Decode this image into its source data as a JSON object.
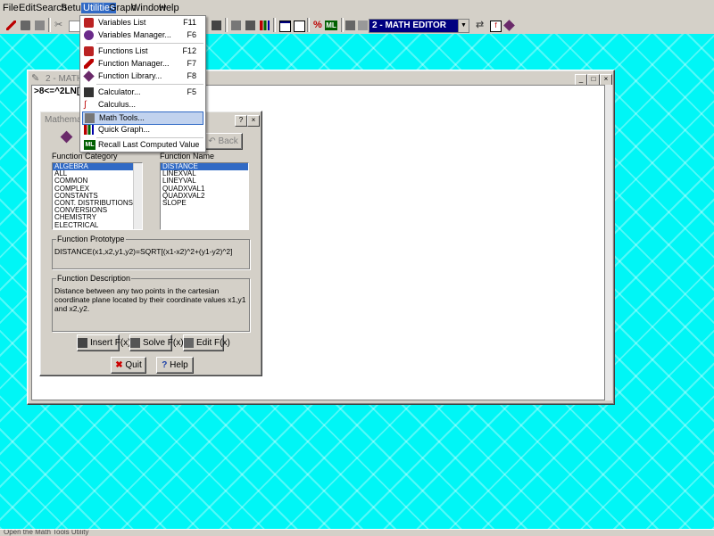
{
  "menubar": {
    "items": [
      {
        "label": "File"
      },
      {
        "label": "Edit"
      },
      {
        "label": "Search"
      },
      {
        "label": "Setup"
      },
      {
        "label": "Utilities"
      },
      {
        "label": "Graph"
      },
      {
        "label": "Window"
      },
      {
        "label": "Help"
      }
    ]
  },
  "toolbar": {
    "editor_combo_value": "2 - MATH EDITOR"
  },
  "utilities_menu": {
    "items": [
      {
        "label": "Variables List",
        "shortcut": "F11"
      },
      {
        "label": "Variables Manager...",
        "shortcut": "F6"
      },
      {
        "label": "Functions List",
        "shortcut": "F12"
      },
      {
        "label": "Function Manager...",
        "shortcut": "F7"
      },
      {
        "label": "Function Library...",
        "shortcut": "F8"
      },
      {
        "label": "Calculator...",
        "shortcut": "F5"
      },
      {
        "label": "Calculus...",
        "shortcut": ""
      },
      {
        "label": "Math Tools...",
        "shortcut": ""
      },
      {
        "label": "Quick Graph...",
        "shortcut": ""
      },
      {
        "label": "Recall Last Computed Value",
        "shortcut": ""
      }
    ]
  },
  "math_editor": {
    "title": "2 - MATH ED",
    "content": ">8<=^2LN[IMA"
  },
  "function_library_dialog": {
    "title": "Mathematical Functions",
    "back_label": "Back",
    "function_category_label": "Function Category",
    "function_name_label": "Function Name",
    "categories": [
      "ALGEBRA",
      "ALL",
      "COMMON",
      "COMPLEX",
      "CONSTANTS",
      "CONT. DISTRIBUTIONS",
      "CONVERSIONS",
      "CHEMISTRY",
      "ELECTRICAL"
    ],
    "selected_category": "ALGEBRA",
    "function_names": [
      "DISTANCE",
      "LINEXVAL",
      "LINEYVAL",
      "QUADXVAL1",
      "QUADXVAL2",
      "SLOPE"
    ],
    "selected_function": "DISTANCE",
    "prototype_title": "Function Prototype",
    "prototype_text": "DISTANCE(x1,x2,y1,y2)=SQRT[(x1-x2)^2+(y1-y2)^2]",
    "description_title": "Function Description",
    "description_text": "Distance between any two points in the cartesian coordinate plane located by their coordinate values x1,y1 and x2,y2.",
    "insert_label": "Insert F(x)",
    "solve_label": "Solve F(x)",
    "edit_label": "Edit F(x)",
    "quit_label": "Quit",
    "help_label": "Help"
  },
  "status": {
    "text": "Open the Math Tools Utility"
  }
}
